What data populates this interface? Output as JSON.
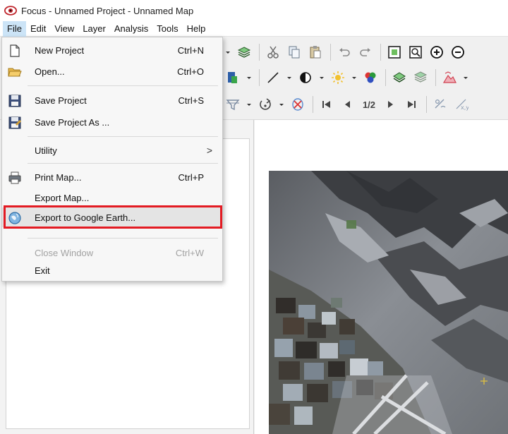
{
  "window": {
    "title": "Focus - Unnamed Project - Unnamed Map",
    "icon": "eye-icon"
  },
  "menubar": {
    "items": [
      "File",
      "Edit",
      "View",
      "Layer",
      "Analysis",
      "Tools",
      "Help"
    ],
    "active": "File"
  },
  "file_menu": {
    "items": [
      {
        "label": "New Project",
        "shortcut": "Ctrl+N",
        "icon": "new-document-icon",
        "enabled": true
      },
      {
        "label": "Open...",
        "shortcut": "Ctrl+O",
        "icon": "open-folder-icon",
        "enabled": true
      },
      {
        "label": "Save Project",
        "shortcut": "Ctrl+S",
        "icon": "floppy-disk-icon",
        "enabled": true
      },
      {
        "label": "Save Project As ...",
        "shortcut": "",
        "icon": "floppy-save-as-icon",
        "enabled": true
      },
      {
        "label": "Utility",
        "shortcut": ">",
        "icon": "",
        "enabled": true
      },
      {
        "label": "Print Map...",
        "shortcut": "Ctrl+P",
        "icon": "printer-icon",
        "enabled": true
      },
      {
        "label": "Export Map...",
        "shortcut": "",
        "icon": "",
        "enabled": true
      },
      {
        "label": "Export to Google Earth...",
        "shortcut": "",
        "icon": "globe-icon",
        "enabled": true,
        "highlighted": true
      },
      {
        "label": "Close Window",
        "shortcut": "Ctrl+W",
        "icon": "",
        "enabled": false
      },
      {
        "label": "Exit",
        "shortcut": "",
        "icon": "",
        "enabled": true
      }
    ]
  },
  "toolbar": {
    "row3_zoom_label": "1/2",
    "icons": [
      "layers-icon",
      "cut-icon",
      "copy-icon",
      "paste-icon",
      "undo-icon",
      "redo-icon",
      "zoom-extent-icon",
      "zoom-window-icon",
      "zoom-in-icon",
      "zoom-out-icon"
    ]
  },
  "colors": {
    "accent_red": "#e31b23",
    "menu_active": "#cce4f7"
  }
}
